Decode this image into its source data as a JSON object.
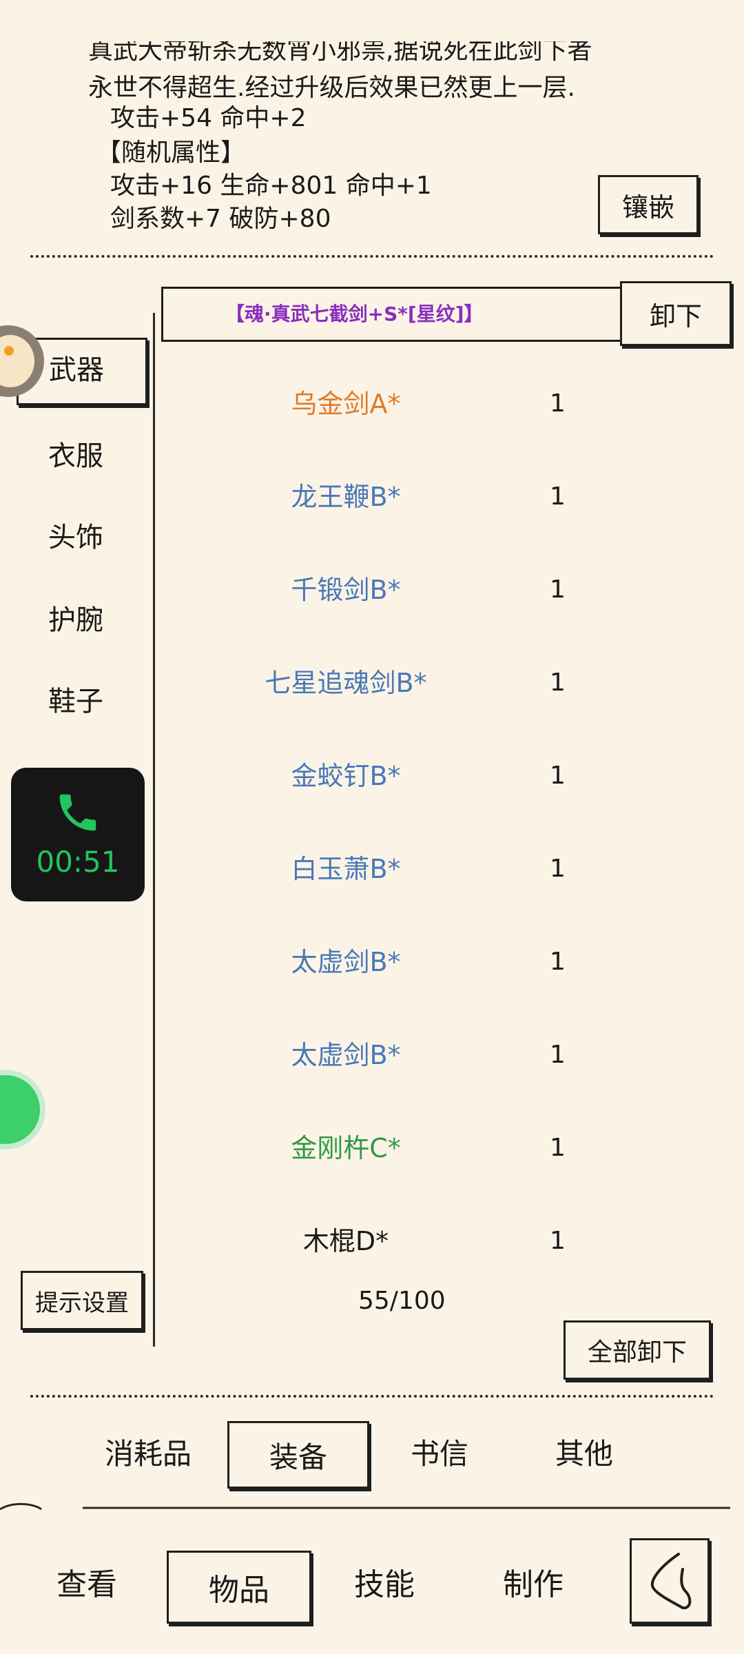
{
  "description": {
    "line1": "真武大帝斩杀无数宵小邪祟,据说死在此剑下者",
    "line2": "永世不得超生.经过升级后效果已然更上一层."
  },
  "base_attrs": "攻击+54 命中+2",
  "random_attrs": {
    "header": "【随机属性】",
    "line1": "攻击+16 生命+801 命中+1",
    "line2": "剑系数+7 破防+80"
  },
  "inlay_button": "镶嵌",
  "equipped": {
    "name": "【魂·真武七截剑+S*[星纹]】",
    "color": "#8a2fc0",
    "unequip_button": "卸下"
  },
  "sidebar": {
    "items": [
      {
        "label": "武器",
        "selected": true
      },
      {
        "label": "衣服"
      },
      {
        "label": "头饰"
      },
      {
        "label": "护腕"
      },
      {
        "label": "鞋子"
      }
    ],
    "hint_settings_button": "提示设置"
  },
  "call_overlay": {
    "timer": "00:51",
    "icon": "phone-icon",
    "accent": "#22c55e"
  },
  "inventory": {
    "items": [
      {
        "name": "乌金剑A*",
        "count": "1",
        "color": "#e07b2a"
      },
      {
        "name": "龙王鞭B*",
        "count": "1",
        "color": "#4a78b8"
      },
      {
        "name": "千锻剑B*",
        "count": "1",
        "color": "#4a78b8"
      },
      {
        "name": "七星追魂剑B*",
        "count": "1",
        "color": "#4a78b8"
      },
      {
        "name": "金蛟钉B*",
        "count": "1",
        "color": "#4a78b8"
      },
      {
        "name": "白玉萧B*",
        "count": "1",
        "color": "#4a78b8"
      },
      {
        "name": "太虚剑B*",
        "count": "1",
        "color": "#4a78b8"
      },
      {
        "name": "太虚剑B*",
        "count": "1",
        "color": "#4a78b8"
      },
      {
        "name": "金刚杵C*",
        "count": "1",
        "color": "#2e9a48"
      },
      {
        "name": "木棍D*",
        "count": "1",
        "color": "#1a1a1a"
      }
    ],
    "capacity": "55/100",
    "unequip_all_button": "全部卸下"
  },
  "category_tabs": [
    {
      "label": "消耗品"
    },
    {
      "label": "装备",
      "selected": true
    },
    {
      "label": "书信"
    },
    {
      "label": "其他"
    }
  ],
  "bottom_nav": [
    {
      "label": "查看"
    },
    {
      "label": "物品",
      "selected": true
    },
    {
      "label": "技能"
    },
    {
      "label": "制作"
    }
  ]
}
